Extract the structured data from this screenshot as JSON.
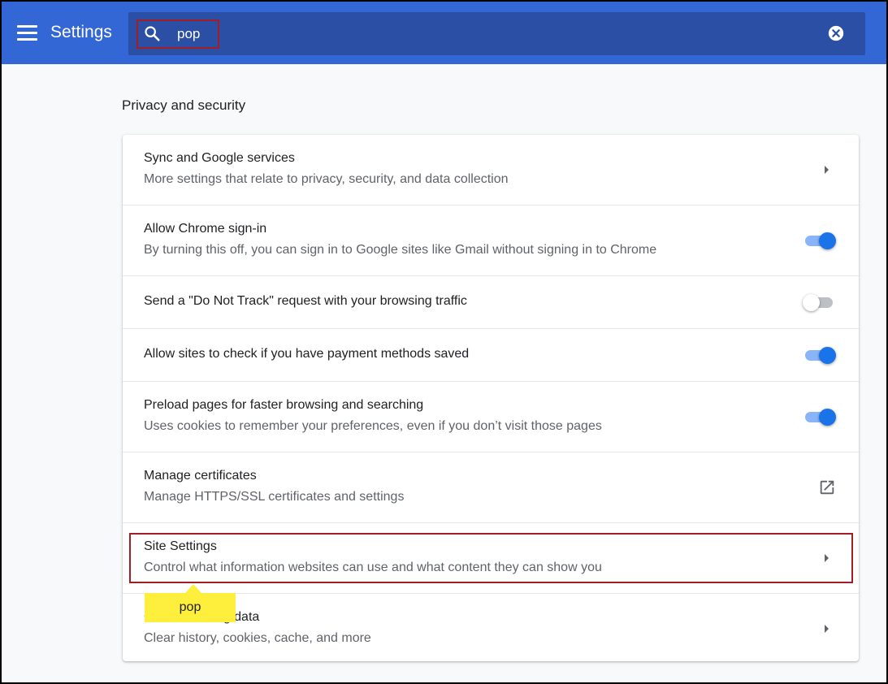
{
  "header": {
    "title": "Settings",
    "menu_icon": "hamburger-menu-icon",
    "search": {
      "icon": "search-icon",
      "value": "pop",
      "clear_icon": "clear-search-icon"
    }
  },
  "section": {
    "title": "Privacy and security"
  },
  "rows": [
    {
      "title": "Sync and Google services",
      "subtitle": "More settings that relate to privacy, security, and data collection",
      "control": "arrow"
    },
    {
      "title": "Allow Chrome sign-in",
      "subtitle": "By turning this off, you can sign in to Google sites like Gmail without signing in to Chrome",
      "control": "toggle",
      "checked": true
    },
    {
      "title": "Send a \"Do Not Track\" request with your browsing traffic",
      "control": "toggle",
      "checked": false
    },
    {
      "title": "Allow sites to check if you have payment methods saved",
      "control": "toggle",
      "checked": true
    },
    {
      "title": "Preload pages for faster browsing and searching",
      "subtitle": "Uses cookies to remember your preferences, even if you don’t visit those pages",
      "control": "toggle",
      "checked": true
    },
    {
      "title": "Manage certificates",
      "subtitle": "Manage HTTPS/SSL certificates and settings",
      "control": "external-link"
    },
    {
      "title": "Site Settings",
      "subtitle": "Control what information websites can use and what content they can show you",
      "control": "arrow"
    },
    {
      "title": "Clear browsing data",
      "title_visible": "g data",
      "subtitle": "Clear history, cookies, cache, and more",
      "control": "arrow"
    }
  ],
  "tooltip": {
    "text": "pop"
  },
  "colors": {
    "header_bg": "#3367d6",
    "search_bg": "#2a4fa5",
    "toggle_on": "#1a73e8",
    "highlight_box": "#a31d27",
    "tooltip_bg": "#fdef3b"
  }
}
